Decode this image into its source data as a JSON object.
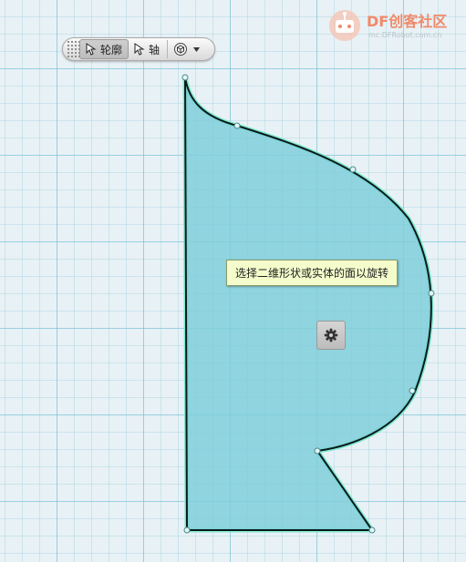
{
  "toolbar": {
    "profile_label": "轮廓",
    "axis_label": "轴",
    "icons": [
      "pointer-icon",
      "pointer-icon",
      "view-cube-icon",
      "dropdown-arrow-icon"
    ]
  },
  "tooltip": {
    "text": "选择二维形状或实体的面以旋转"
  },
  "settings_button": {
    "icon": "gear-icon"
  },
  "watermark": {
    "brand": "DF创客社区",
    "site": "mc.DFRobot.com.cn"
  },
  "colors": {
    "shape_fill": "#7fcfd9",
    "shape_outline": "#0a1a1a",
    "shape_glow": "#6fe0c8",
    "tooltip_bg": "#f4fccb",
    "grid": "#7ec3da",
    "brand": "#f08a6a"
  }
}
